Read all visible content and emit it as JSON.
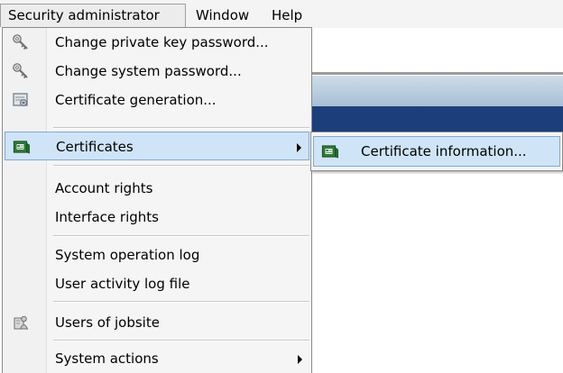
{
  "menubar": {
    "items": [
      {
        "label": "Security administrator"
      },
      {
        "label": "Window"
      },
      {
        "label": "Help"
      }
    ]
  },
  "security_menu": {
    "items": [
      {
        "label": "Change private key password...",
        "icon": "key-icon"
      },
      {
        "label": "Change system password...",
        "icon": "key-icon"
      },
      {
        "label": "Certificate generation...",
        "icon": "certificate-generation-icon"
      },
      {
        "label": "Certificates",
        "icon": "certificates-icon",
        "has_submenu": true,
        "highlighted": true
      },
      {
        "label": "Account rights"
      },
      {
        "label": "Interface rights"
      },
      {
        "label": "System operation log"
      },
      {
        "label": "User activity log file"
      },
      {
        "label": "Users of jobsite",
        "icon": "users-icon"
      },
      {
        "label": "System actions",
        "has_submenu": true
      }
    ]
  },
  "certificates_submenu": {
    "items": [
      {
        "label": "Certificate information...",
        "icon": "certificates-icon",
        "highlighted": true
      }
    ]
  },
  "colors": {
    "highlight_bg": "#cfe4f7",
    "highlight_border": "#7fa9d6",
    "menu_bg": "#f5f5f5",
    "app_blue": "#1c3f7c"
  }
}
